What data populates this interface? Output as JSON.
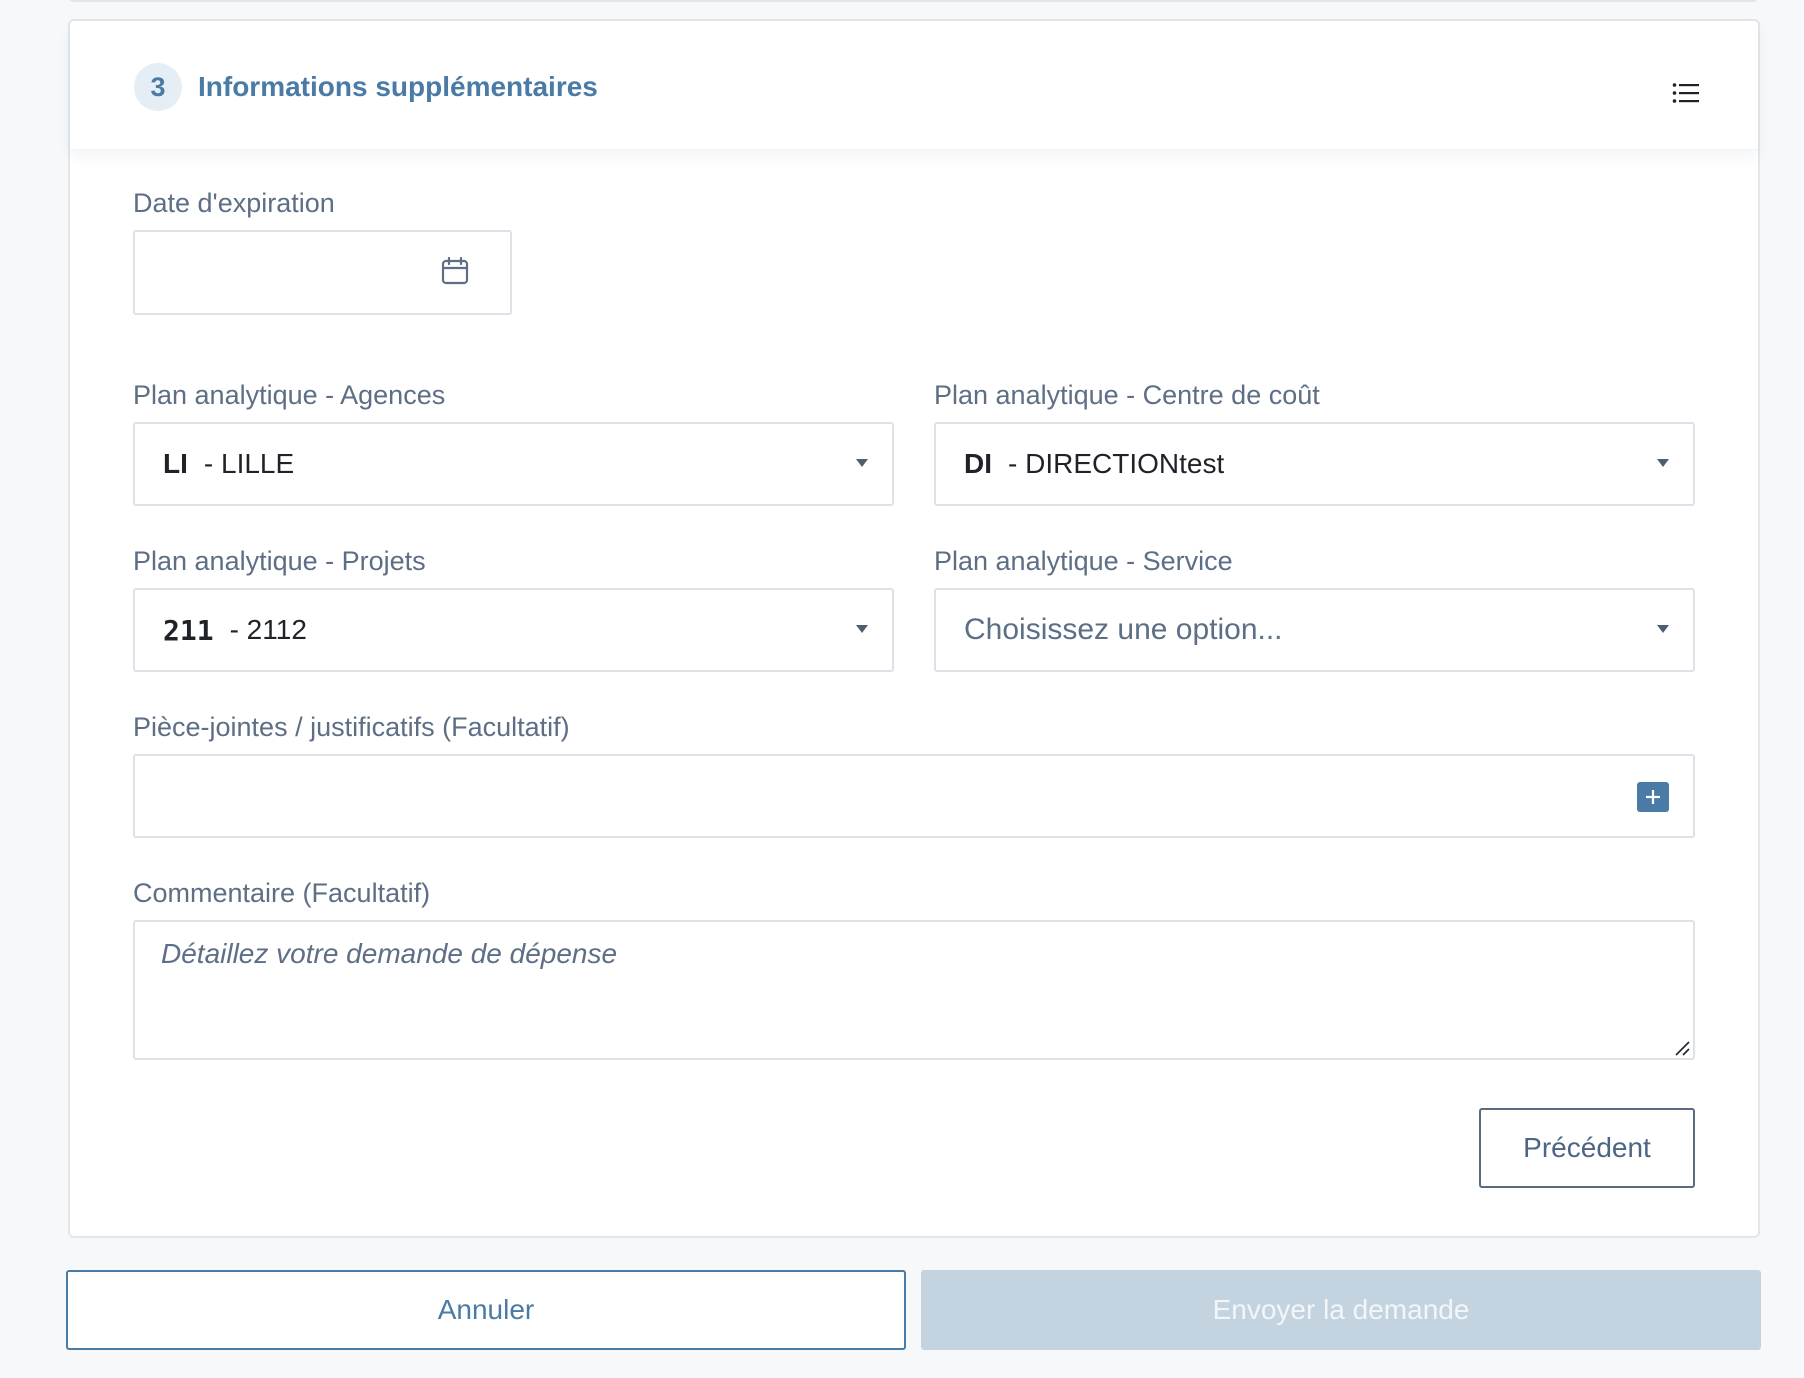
{
  "section": {
    "step_number": "3",
    "title": "Informations supplémentaires",
    "menu_icon": "list-icon"
  },
  "fields": {
    "expiration_date": {
      "label": "Date d'expiration",
      "value": "",
      "icon": "calendar-icon"
    },
    "agences": {
      "label": "Plan analytique - Agences",
      "code": "LI",
      "value": "- LILLE"
    },
    "centre_cout": {
      "label": "Plan analytique - Centre de coût",
      "code": "DI",
      "value": "- DIRECTIONtest"
    },
    "projets": {
      "label": "Plan analytique - Projets",
      "code": "211",
      "value": "- 2112"
    },
    "service": {
      "label": "Plan analytique - Service",
      "placeholder": "Choisissez une option..."
    },
    "attachments": {
      "label": "Pièce-jointes / justificatifs (Facultatif)",
      "icon": "plus-icon"
    },
    "comment": {
      "label": "Commentaire (Facultatif)",
      "placeholder": "Détaillez votre demande de dépense",
      "value": ""
    }
  },
  "buttons": {
    "previous": "Précédent",
    "cancel": "Annuler",
    "send": "Envoyer la demande"
  },
  "colors": {
    "accent": "#4a7aa6",
    "label": "#5d6e85",
    "border": "#dde2e8",
    "disabled_button": "#c3d4e0",
    "background": "#f6f8fa"
  }
}
